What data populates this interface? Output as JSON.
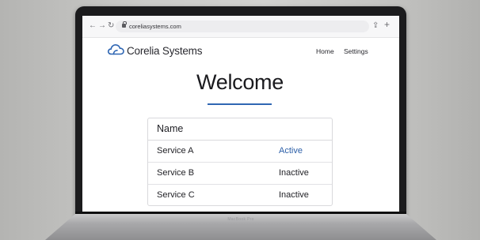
{
  "browser": {
    "back_glyph": "←",
    "forward_glyph": "→",
    "reload_glyph": "↻",
    "url": "coreliasystems.com",
    "share_glyph": "⇪",
    "new_tab_glyph": "+"
  },
  "header": {
    "brand": "Corelia Systems",
    "nav": {
      "home": "Home",
      "settings": "Settings"
    }
  },
  "main": {
    "title": "Welcome",
    "table": {
      "header": "Name",
      "rows": [
        {
          "name": "Service A",
          "status": "Active"
        },
        {
          "name": "Service B",
          "status": "Inactive"
        },
        {
          "name": "Service C",
          "status": "Inactive"
        }
      ]
    }
  },
  "device": {
    "model_label": "MacBook Pro"
  },
  "colors": {
    "accent": "#2f66b3",
    "active_status": "#2c5fa8",
    "text": "#1f1f24"
  },
  "icons": {
    "logo": "cloud-icon",
    "lock": "lock-icon"
  }
}
